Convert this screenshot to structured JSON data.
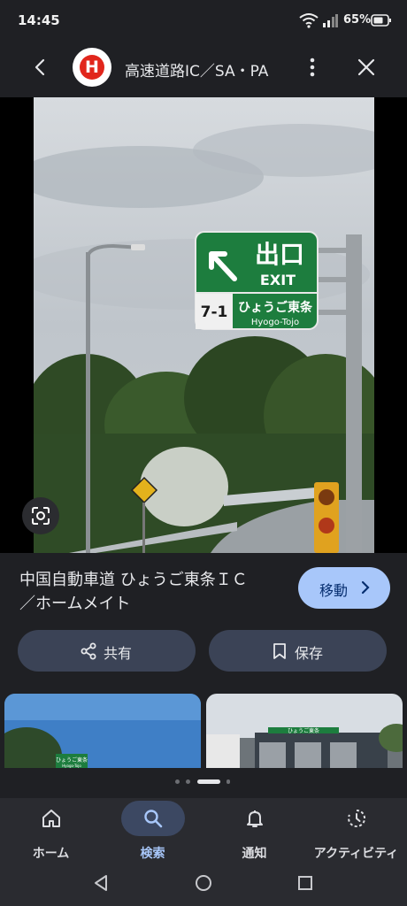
{
  "status_bar": {
    "time": "14:45",
    "battery_percent": "65%",
    "icons": [
      "wifi-icon",
      "signal-icon",
      "battery-icon"
    ]
  },
  "top_bar": {
    "site_logo_letter": "H",
    "site_title": "高速道路IC／SA・PA",
    "icons": [
      "back-arrow-icon",
      "more-vert-icon",
      "close-icon"
    ]
  },
  "photo_sign": {
    "line1": "出口",
    "line2": "EXIT",
    "number": "7-1",
    "name_ja": "ひょうご東条",
    "name_en": "Hyogo-Tojo"
  },
  "caption": {
    "line1": "中国自動車道 ひょうご東条ＩＣ",
    "line2": "／ホームメイト"
  },
  "actions": {
    "visit_label": "移動",
    "share_label": "共有",
    "save_label": "保存"
  },
  "related": [
    {
      "sign_text": "ひょうご東条",
      "sign_sub": "Hyogo-Tojo"
    },
    {
      "sign_text": "ひょうご東条"
    }
  ],
  "bottom_nav": [
    {
      "label": "ホーム",
      "icon": "home-icon",
      "active": false
    },
    {
      "label": "検索",
      "icon": "search-icon",
      "active": true
    },
    {
      "label": "通知",
      "icon": "bell-icon",
      "active": false
    },
    {
      "label": "アクティビティ",
      "icon": "activity-icon",
      "active": false
    }
  ],
  "colors": {
    "background": "#1f2024",
    "accent_button": "#a8c7fa",
    "secondary_button": "#3b4356",
    "logo_red": "#e1261c",
    "sign_green": "#1d7d3e"
  }
}
